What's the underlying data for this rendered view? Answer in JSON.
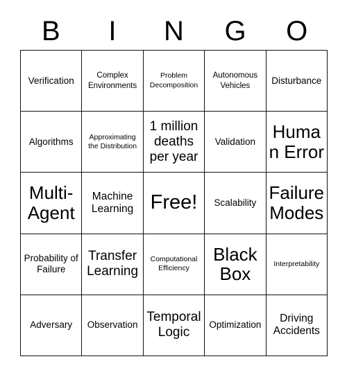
{
  "card": {
    "title": "BINGO",
    "header_letters": [
      "B",
      "I",
      "N",
      "G",
      "O"
    ],
    "free_space_label": "Free!",
    "colors": {
      "background": "#ffffff",
      "border": "#111111",
      "text": "#000000"
    },
    "grid": {
      "columns": 5,
      "rows": 5
    },
    "cells": [
      {
        "text": "Verification",
        "size": "md",
        "free": false
      },
      {
        "text": "Complex Environments",
        "size": "sm",
        "free": false
      },
      {
        "text": "Problem Decomposition",
        "size": "xs",
        "free": false
      },
      {
        "text": "Autonomous Vehicles",
        "size": "sm",
        "free": false
      },
      {
        "text": "Disturbance",
        "size": "md",
        "free": false
      },
      {
        "text": "Algorithms",
        "size": "md",
        "free": false
      },
      {
        "text": "Approximating the Distribution",
        "size": "xs",
        "free": false
      },
      {
        "text": "1 million deaths per year",
        "size": "xl",
        "free": false
      },
      {
        "text": "Validation",
        "size": "md",
        "free": false
      },
      {
        "text": "Human Error",
        "size": "xxl",
        "free": false
      },
      {
        "text": "Multi-Agent",
        "size": "xxl",
        "free": false
      },
      {
        "text": "Machine Learning",
        "size": "lg",
        "free": false
      },
      {
        "text": "Free!",
        "size": "free",
        "free": true
      },
      {
        "text": "Scalability",
        "size": "md",
        "free": false
      },
      {
        "text": "Failure Modes",
        "size": "xxl",
        "free": false
      },
      {
        "text": "Probability of Failure",
        "size": "md",
        "free": false
      },
      {
        "text": "Transfer Learning",
        "size": "xl",
        "free": false
      },
      {
        "text": "Computational Efficiency",
        "size": "xs",
        "free": false
      },
      {
        "text": "Black Box",
        "size": "xxl",
        "free": false
      },
      {
        "text": "Interpretability",
        "size": "xs",
        "free": false
      },
      {
        "text": "Adversary",
        "size": "md",
        "free": false
      },
      {
        "text": "Observation",
        "size": "md",
        "free": false
      },
      {
        "text": "Temporal Logic",
        "size": "xl",
        "free": false
      },
      {
        "text": "Optimization",
        "size": "md",
        "free": false
      },
      {
        "text": "Driving Accidents",
        "size": "lg",
        "free": false
      }
    ]
  }
}
